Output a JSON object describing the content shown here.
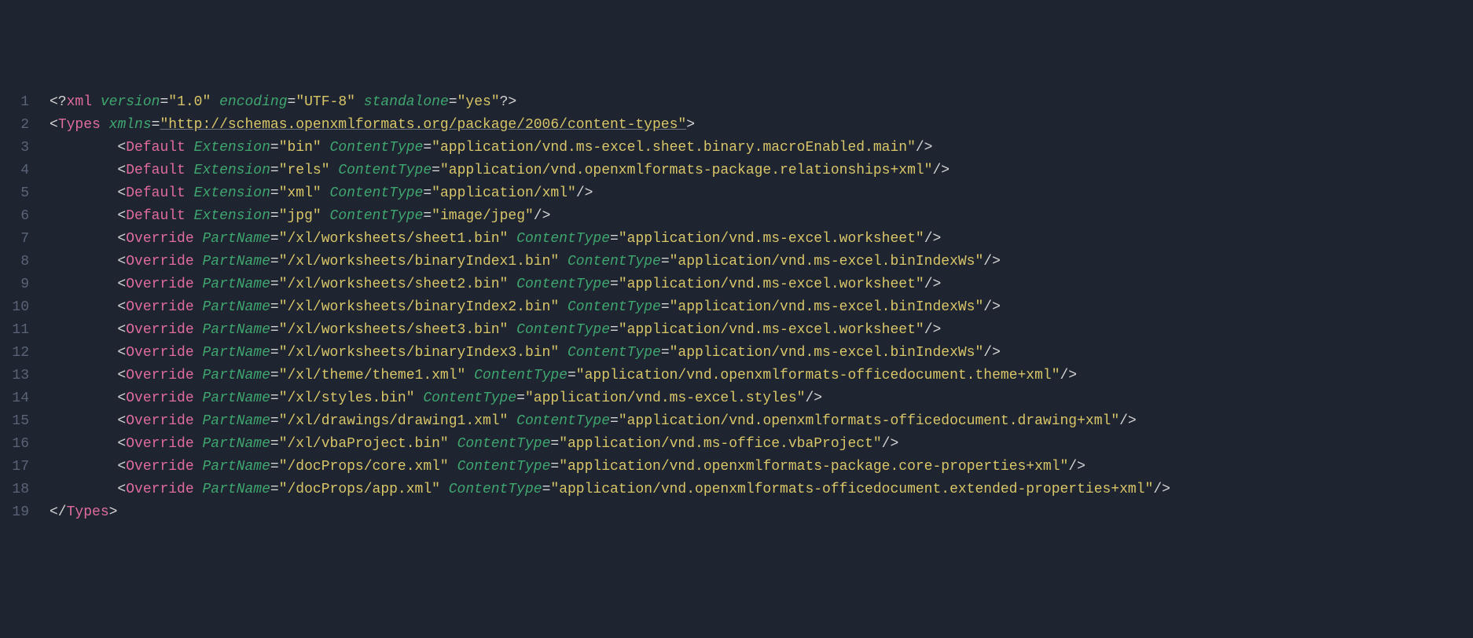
{
  "lineNumbers": [
    "1",
    "2",
    "3",
    "4",
    "5",
    "6",
    "7",
    "8",
    "9",
    "10",
    "11",
    "12",
    "13",
    "14",
    "15",
    "16",
    "17",
    "18",
    "19"
  ],
  "xmlDecl": {
    "target": "xml",
    "attrs": [
      {
        "name": "version",
        "value": "\"1.0\""
      },
      {
        "name": "encoding",
        "value": "\"UTF-8\""
      },
      {
        "name": "standalone",
        "value": "\"yes\""
      }
    ]
  },
  "typesOpen": {
    "tag": "Types",
    "attrs": [
      {
        "name": "xmlns",
        "value": "\"http://schemas.openxmlformats.org/package/2006/content-types\""
      }
    ]
  },
  "defaults": [
    {
      "tag": "Default",
      "ext": "\"bin\"",
      "ct": "\"application/vnd.ms-excel.sheet.binary.macroEnabled.main\""
    },
    {
      "tag": "Default",
      "ext": "\"rels\"",
      "ct": "\"application/vnd.openxmlformats-package.relationships+xml\""
    },
    {
      "tag": "Default",
      "ext": "\"xml\"",
      "ct": "\"application/xml\""
    },
    {
      "tag": "Default",
      "ext": "\"jpg\"",
      "ct": "\"image/jpeg\""
    }
  ],
  "overrides": [
    {
      "tag": "Override",
      "pn": "\"/xl/worksheets/sheet1.bin\"",
      "ct": "\"application/vnd.ms-excel.worksheet\""
    },
    {
      "tag": "Override",
      "pn": "\"/xl/worksheets/binaryIndex1.bin\"",
      "ct": "\"application/vnd.ms-excel.binIndexWs\""
    },
    {
      "tag": "Override",
      "pn": "\"/xl/worksheets/sheet2.bin\"",
      "ct": "\"application/vnd.ms-excel.worksheet\""
    },
    {
      "tag": "Override",
      "pn": "\"/xl/worksheets/binaryIndex2.bin\"",
      "ct": "\"application/vnd.ms-excel.binIndexWs\""
    },
    {
      "tag": "Override",
      "pn": "\"/xl/worksheets/sheet3.bin\"",
      "ct": "\"application/vnd.ms-excel.worksheet\""
    },
    {
      "tag": "Override",
      "pn": "\"/xl/worksheets/binaryIndex3.bin\"",
      "ct": "\"application/vnd.ms-excel.binIndexWs\""
    },
    {
      "tag": "Override",
      "pn": "\"/xl/theme/theme1.xml\"",
      "ct": "\"application/vnd.openxmlformats-officedocument.theme+xml\""
    },
    {
      "tag": "Override",
      "pn": "\"/xl/styles.bin\"",
      "ct": "\"application/vnd.ms-excel.styles\""
    },
    {
      "tag": "Override",
      "pn": "\"/xl/drawings/drawing1.xml\"",
      "ct": "\"application/vnd.openxmlformats-officedocument.drawing+xml\""
    },
    {
      "tag": "Override",
      "pn": "\"/xl/vbaProject.bin\"",
      "ct": "\"application/vnd.ms-office.vbaProject\""
    },
    {
      "tag": "Override",
      "pn": "\"/docProps/core.xml\"",
      "ct": "\"application/vnd.openxmlformats-package.core-properties+xml\""
    },
    {
      "tag": "Override",
      "pn": "\"/docProps/app.xml\"",
      "ct": "\"application/vnd.openxmlformats-officedocument.extended-properties+xml\""
    }
  ],
  "typesClose": {
    "tag": "Types"
  },
  "labels": {
    "Extension": "Extension",
    "ContentType": "ContentType",
    "PartName": "PartName"
  }
}
